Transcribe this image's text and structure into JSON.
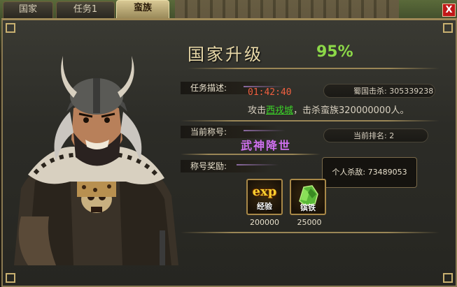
{
  "tabs": [
    {
      "label": "国家"
    },
    {
      "label": "任务1"
    },
    {
      "label": "蛮族"
    }
  ],
  "window": {
    "close_label": "X"
  },
  "header": {
    "title": "国家升级",
    "progress": "95%",
    "progress_value": 0.95
  },
  "task": {
    "label": "任务描述:",
    "timer": "01:42:40",
    "kills_label": "蜀国击杀:",
    "kills_value": "305339238",
    "desc_prefix": "攻击",
    "desc_link": "西戎城",
    "desc_suffix": "，击杀蛮族320000000人。"
  },
  "title_section": {
    "label": "当前称号:",
    "title": "武神降世",
    "rank_label": "当前排名:",
    "rank_value": "2"
  },
  "reward_section": {
    "label": "称号奖励:",
    "tooltip": "个人杀敌: 73489053",
    "items": [
      {
        "icon": "exp-icon",
        "icon_text": "exp",
        "name": "经验",
        "value": "200000"
      },
      {
        "icon": "iron-ore-icon",
        "name": "镔铁",
        "value": "25000"
      }
    ]
  },
  "colors": {
    "accent_gold": "#a08a58",
    "progress_green": "#8cd848",
    "timer_red": "#f06040",
    "title_purple": "#d070f0",
    "link_green": "#3cd828"
  }
}
